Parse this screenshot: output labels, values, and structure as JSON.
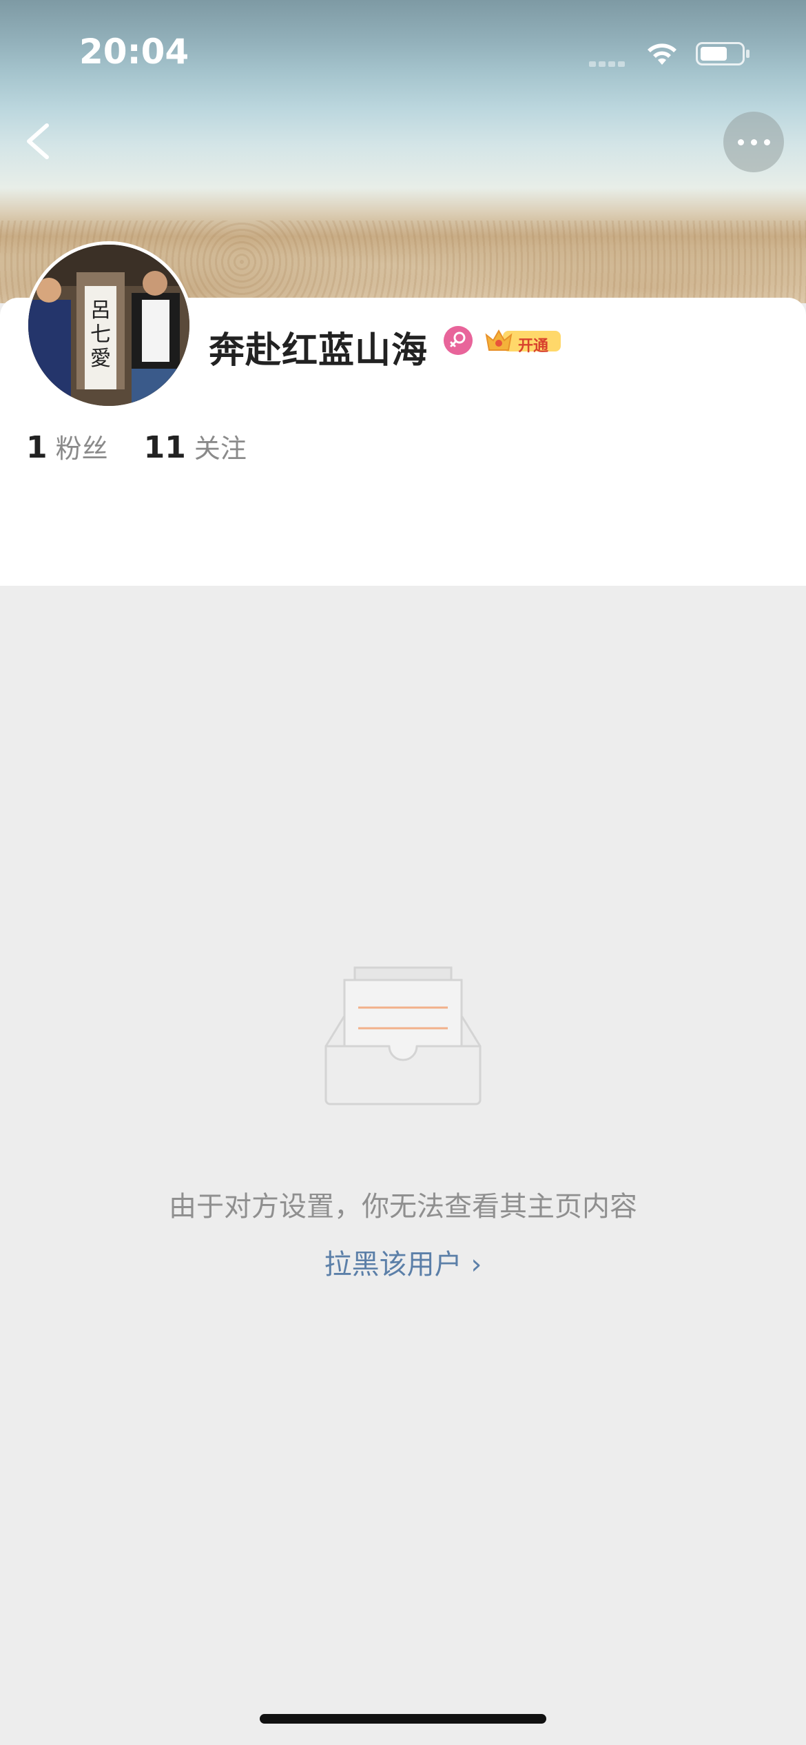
{
  "status_bar": {
    "time": "20:04"
  },
  "profile": {
    "username": "奔赴红蓝山海",
    "vip_label": "开通",
    "stats": [
      {
        "value": "1",
        "label": "粉丝"
      },
      {
        "value": "11",
        "label": "关注"
      }
    ]
  },
  "empty_state": {
    "message": "由于对方设置，你无法查看其主页内容",
    "block_link": "拉黑该用户 ›"
  },
  "colors": {
    "link": "#5b7fa8",
    "female_badge": "#e8649a",
    "vip_badge": "#f4b23a",
    "background": "#ededed"
  }
}
